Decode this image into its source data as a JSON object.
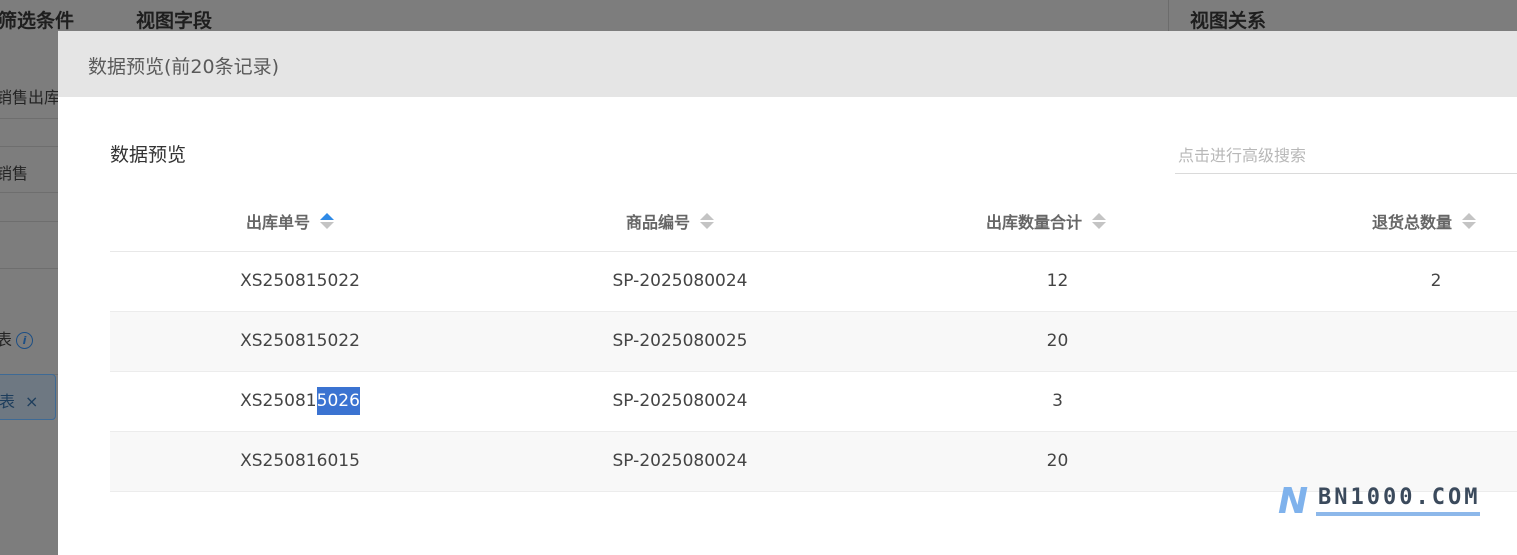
{
  "background": {
    "header": {
      "filter_conditions": "筛选条件",
      "view_fields": "视图字段",
      "view_relations": "视图关系"
    },
    "left_items": [
      "销售出库",
      "销售",
      "表"
    ],
    "tag": {
      "label": "表",
      "close": "×"
    },
    "info_icon": "i"
  },
  "modal": {
    "title": "数据预览(前20条记录)",
    "section_title": "数据预览",
    "search": {
      "placeholder": "点击进行高级搜索",
      "value": ""
    },
    "table": {
      "columns": [
        "出库单号",
        "商品编号",
        "出库数量合计",
        "退货总数量"
      ],
      "sort_active_column": "出库单号",
      "rows": [
        {
          "order_no": "XS250815022",
          "product_no": "SP-2025080024",
          "qty": "12",
          "returns": "2"
        },
        {
          "order_no": "XS250815022",
          "product_no": "SP-2025080025",
          "qty": "20",
          "returns": ""
        },
        {
          "order_no_a": "XS25081",
          "order_no_b": "5026",
          "product_no": "SP-2025080024",
          "qty": "3",
          "returns": ""
        },
        {
          "order_no": "XS250816015",
          "product_no": "SP-2025080024",
          "qty": "20",
          "returns": ""
        }
      ]
    }
  },
  "watermark": {
    "logo_letter": "N",
    "text": "BN1000.COM"
  },
  "colors": {
    "accent": "#2f8ae6",
    "selection": "#3b73d1",
    "header_bg": "#e5e5e5",
    "watermark": "#7fb2ec"
  }
}
